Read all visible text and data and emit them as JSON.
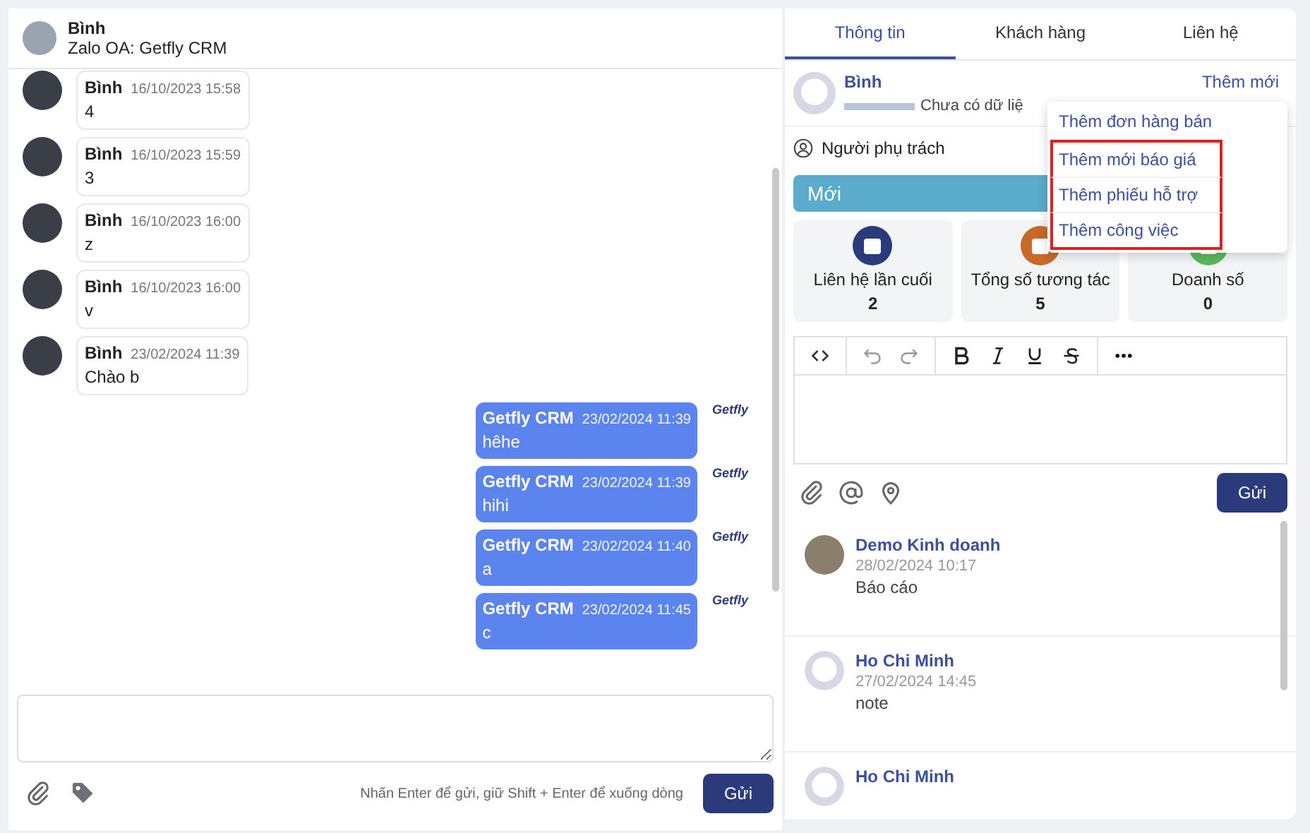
{
  "chat": {
    "contact": {
      "name": "Bình",
      "subtitle": "Zalo OA: Getfly CRM"
    },
    "messages": [
      {
        "kind": "incoming",
        "sender": "Bình",
        "time": "16/10/2023 15:58",
        "text": "4"
      },
      {
        "kind": "incoming",
        "sender": "Bình",
        "time": "16/10/2023 15:59",
        "text": "3"
      },
      {
        "kind": "incoming",
        "sender": "Bình",
        "time": "16/10/2023 16:00",
        "text": "z"
      },
      {
        "kind": "incoming",
        "sender": "Bình",
        "time": "16/10/2023 16:00",
        "text": "v"
      },
      {
        "kind": "incoming",
        "sender": "Bình",
        "time": "23/02/2024 11:39",
        "text": "Chào b"
      },
      {
        "kind": "outgoing",
        "sender": "Getfly CRM",
        "time": "23/02/2024 11:39",
        "text": "hêhe",
        "logo": "Getfly"
      },
      {
        "kind": "outgoing",
        "sender": "Getfly CRM",
        "time": "23/02/2024 11:39",
        "text": "hihi",
        "logo": "Getfly"
      },
      {
        "kind": "outgoing",
        "sender": "Getfly CRM",
        "time": "23/02/2024 11:40",
        "text": "a",
        "logo": "Getfly"
      },
      {
        "kind": "outgoing",
        "sender": "Getfly CRM",
        "time": "23/02/2024 11:45",
        "text": "c",
        "logo": "Getfly"
      }
    ],
    "hint": "Nhấn Enter để gửi, giữ Shift + Enter để xuống dòng",
    "send": "Gửi"
  },
  "panel": {
    "tabs": [
      {
        "label": "Thông tin",
        "selected": true
      },
      {
        "label": "Khách hàng",
        "selected": false
      },
      {
        "label": "Liên hệ",
        "selected": false
      }
    ],
    "contact": {
      "name": "Bình",
      "detail": "Chưa có dữ liệ",
      "add_new": "Thêm mới"
    },
    "menu": [
      {
        "label": "Thêm đơn hàng bán",
        "highlighted": false
      },
      {
        "label": "Thêm mới báo giá",
        "highlighted": true
      },
      {
        "label": "Thêm phiếu hỗ trợ",
        "highlighted": true
      },
      {
        "label": "Thêm công việc",
        "highlighted": true
      }
    ],
    "owner_label": "Người phụ trách",
    "stage": {
      "label": "Mới",
      "color": "#5aabcc"
    },
    "stats": [
      {
        "label": "Liên hệ lần cuối",
        "value": "2",
        "color": "#2b3a7a"
      },
      {
        "label": "Tổng số tương tác",
        "value": "5",
        "color": "#c8692a"
      },
      {
        "label": "Doanh số",
        "value": "0",
        "color": "#5cb85c"
      }
    ],
    "send": "Gửi",
    "comments": [
      {
        "author": "Demo Kinh doanh",
        "time": "28/02/2024 10:17",
        "text": "Báo cáo",
        "kind": "photo"
      },
      {
        "author": "Ho Chi Minh",
        "time": "27/02/2024 14:45",
        "text": "note",
        "kind": "default"
      },
      {
        "author": "Ho Chi Minh",
        "kind": "default"
      }
    ]
  }
}
